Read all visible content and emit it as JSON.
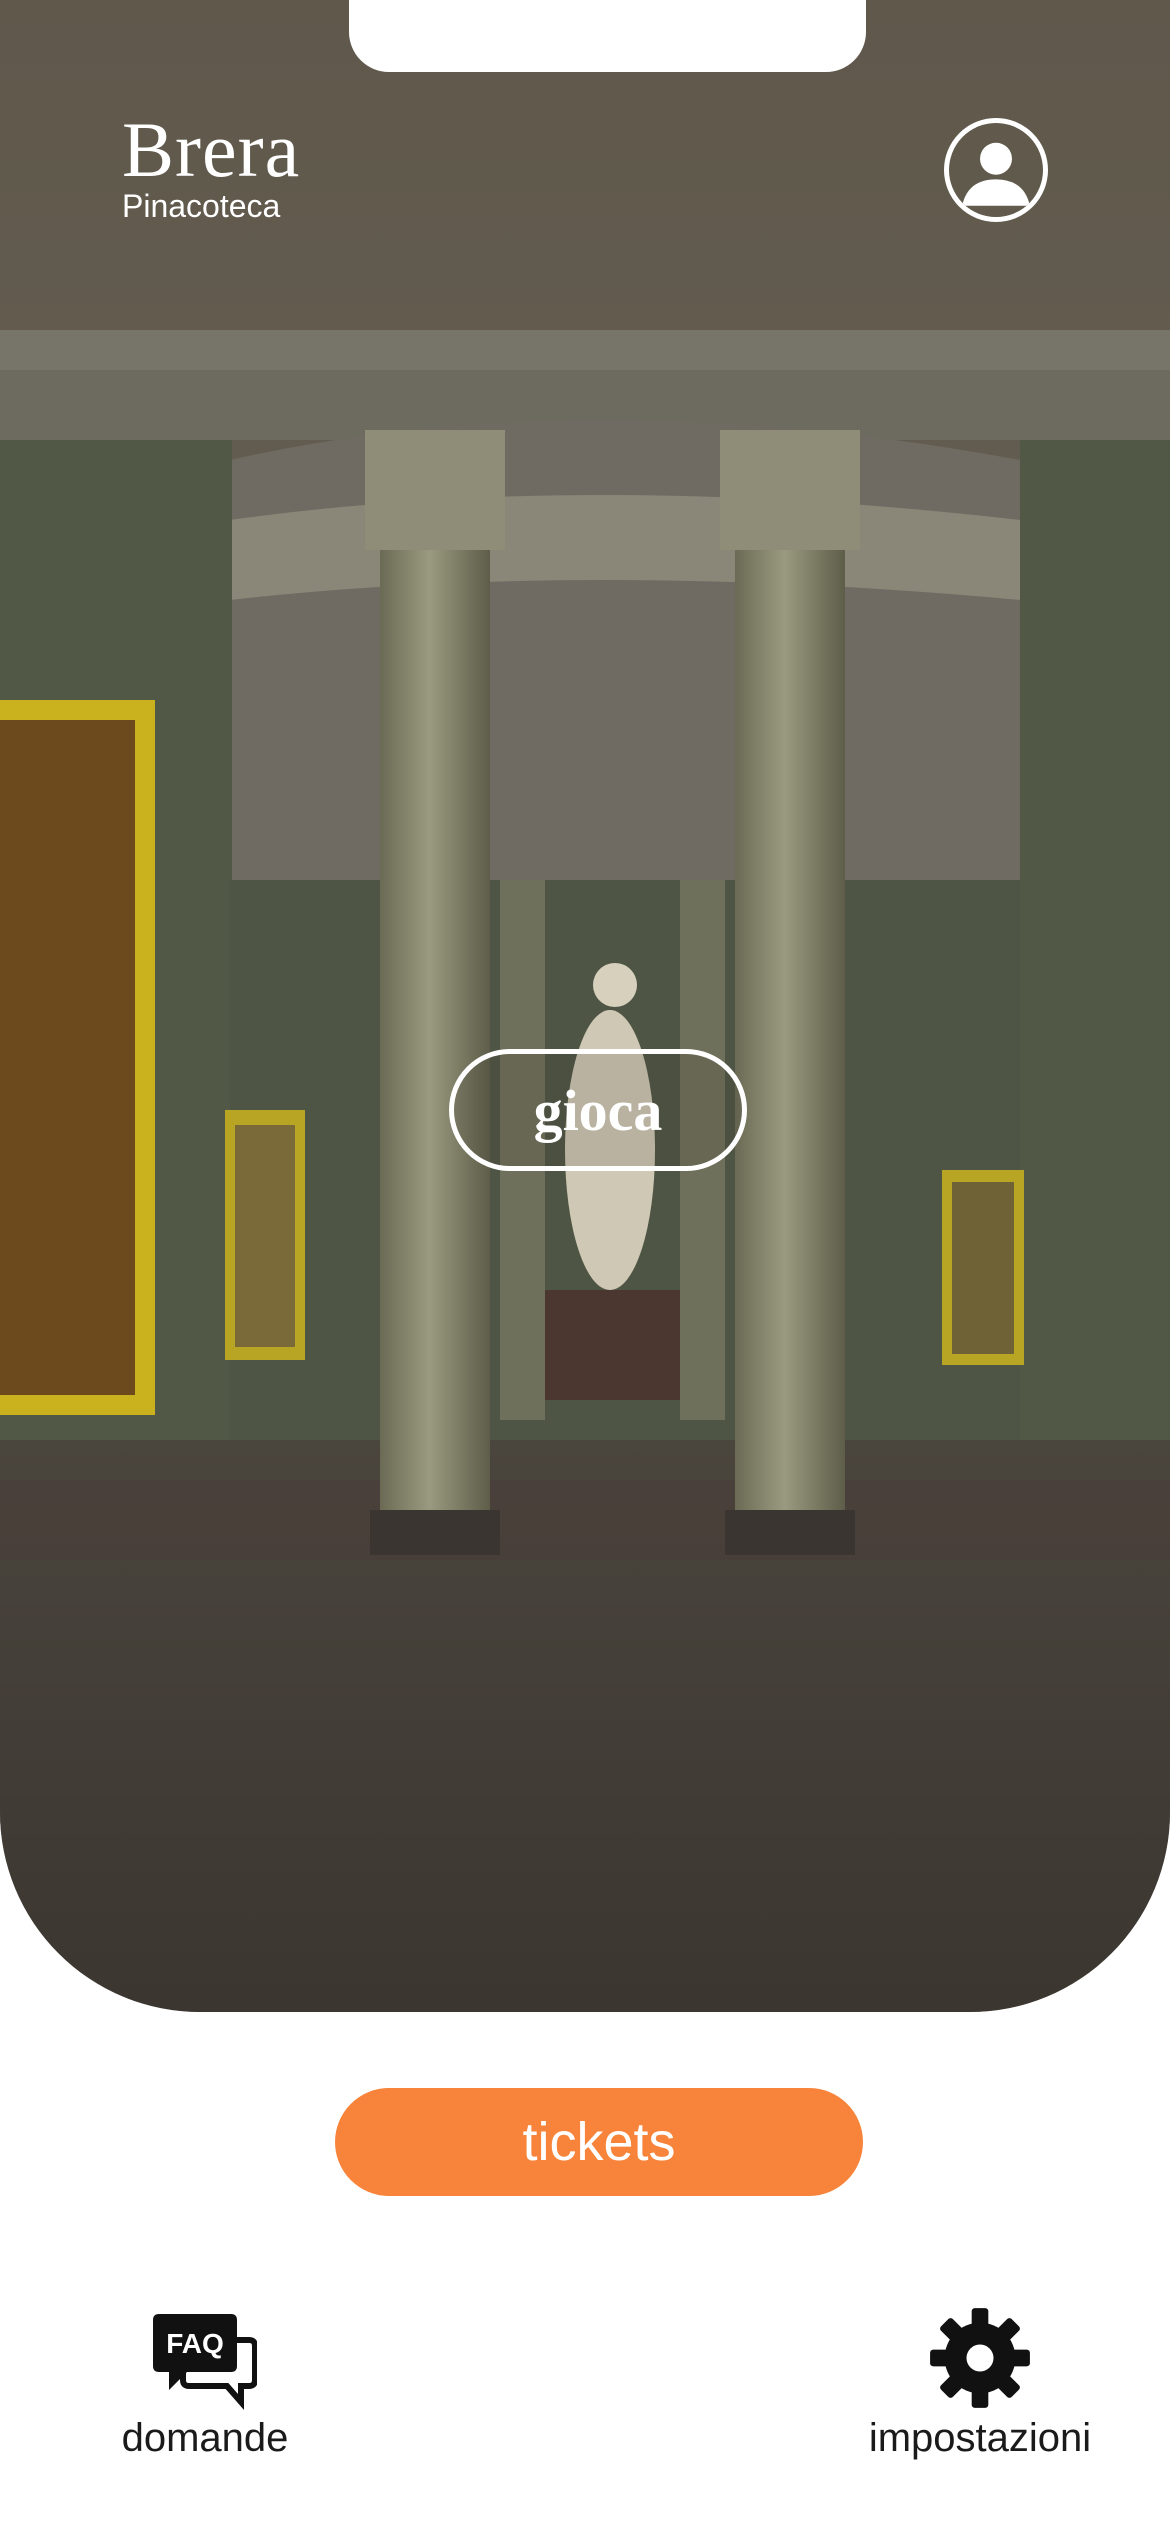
{
  "brand": {
    "title": "Brera",
    "subtitle": "Pinacoteca"
  },
  "hero": {
    "play_label": "gioca"
  },
  "tickets": {
    "label": "tickets",
    "color": "#F7843A"
  },
  "nav": {
    "faq": {
      "icon_text": "FAQ",
      "label": "domande",
      "icon": "faq-chat-icon"
    },
    "settings": {
      "label": "impostazioni",
      "icon": "gear-icon"
    }
  },
  "profile": {
    "icon": "user-profile-icon"
  }
}
